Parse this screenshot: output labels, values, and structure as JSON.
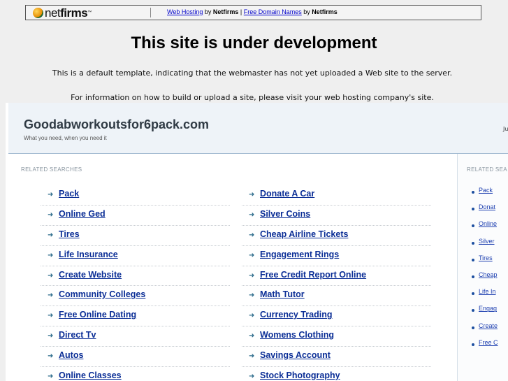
{
  "netfirms_bar": {
    "logo_prefix": "net",
    "logo_bold": "firms",
    "logo_tm": "™",
    "link1": "Web Hosting",
    "by1": " by ",
    "brand1": "Netfirms",
    "divider": " | ",
    "link2": "Free Domain Names",
    "by2": " by ",
    "brand2": "Netfirms"
  },
  "page": {
    "title": "This site is under development",
    "description1": "This is a default template, indicating that the webmaster has not yet uploaded a Web site to the server.",
    "description2": "For information on how to build or upload a site, please visit your web hosting company's site."
  },
  "parked": {
    "site_name": "Goodabworkoutsfor6pack.com",
    "tagline": "What you need, when you need it",
    "header_right": "Ju",
    "related_label": "RELATED SEARCHES",
    "right_label": "RELATED SEA",
    "column_a": [
      "Pack",
      "Online Ged",
      "Tires",
      "Life Insurance",
      "Create Website",
      "Community Colleges",
      "Free Online Dating",
      "Direct Tv",
      "Autos",
      "Online Classes"
    ],
    "column_b": [
      "Donate A Car",
      "Silver Coins",
      "Cheap Airline Tickets",
      "Engagement Rings",
      "Free Credit Report Online",
      "Math Tutor",
      "Currency Trading",
      "Womens Clothing",
      "Savings Account",
      "Stock Photography"
    ],
    "column_right": [
      "Pack",
      "Donat",
      "Online",
      "Silver",
      "Tires",
      "Cheap",
      "Life In",
      "Engag",
      "Create",
      "Free C"
    ]
  },
  "colors": {
    "link": "#0b2e96",
    "header_bg": "#eef3f8",
    "page_bg": "#efefef"
  }
}
